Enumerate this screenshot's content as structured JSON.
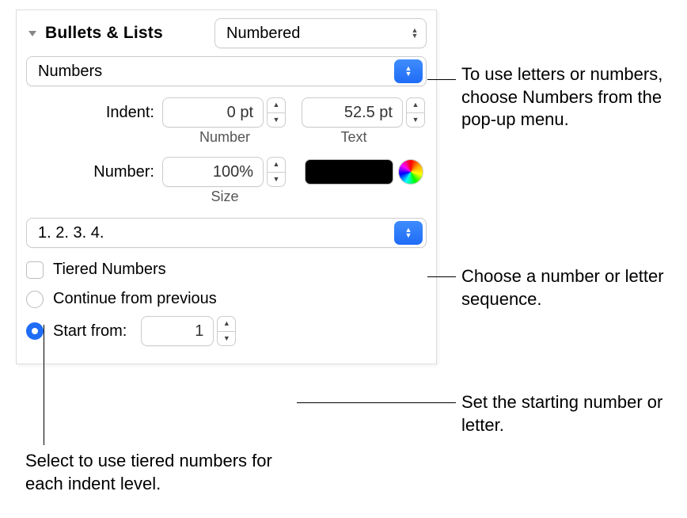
{
  "section": {
    "title": "Bullets & Lists"
  },
  "list_type": {
    "value": "Numbered"
  },
  "bullet_format": {
    "value": "Numbers"
  },
  "indent": {
    "label": "Indent:",
    "number_value": "0 pt",
    "text_value": "52.5 pt",
    "number_sublabel": "Number",
    "text_sublabel": "Text"
  },
  "number_size": {
    "label": "Number:",
    "value": "100%",
    "sublabel": "Size"
  },
  "sequence": {
    "value": "1. 2. 3. 4."
  },
  "tiered": {
    "label": "Tiered Numbers",
    "checked": false
  },
  "continue": {
    "label": "Continue from previous",
    "selected": false
  },
  "start_from": {
    "label": "Start from:",
    "selected": true,
    "value": "1"
  },
  "callouts": {
    "format": "To use letters or numbers, choose Numbers from the pop-up menu.",
    "sequence": "Choose a number or letter sequence.",
    "start": "Set the starting number or letter.",
    "tiered": "Select to use tiered numbers for each indent level."
  }
}
